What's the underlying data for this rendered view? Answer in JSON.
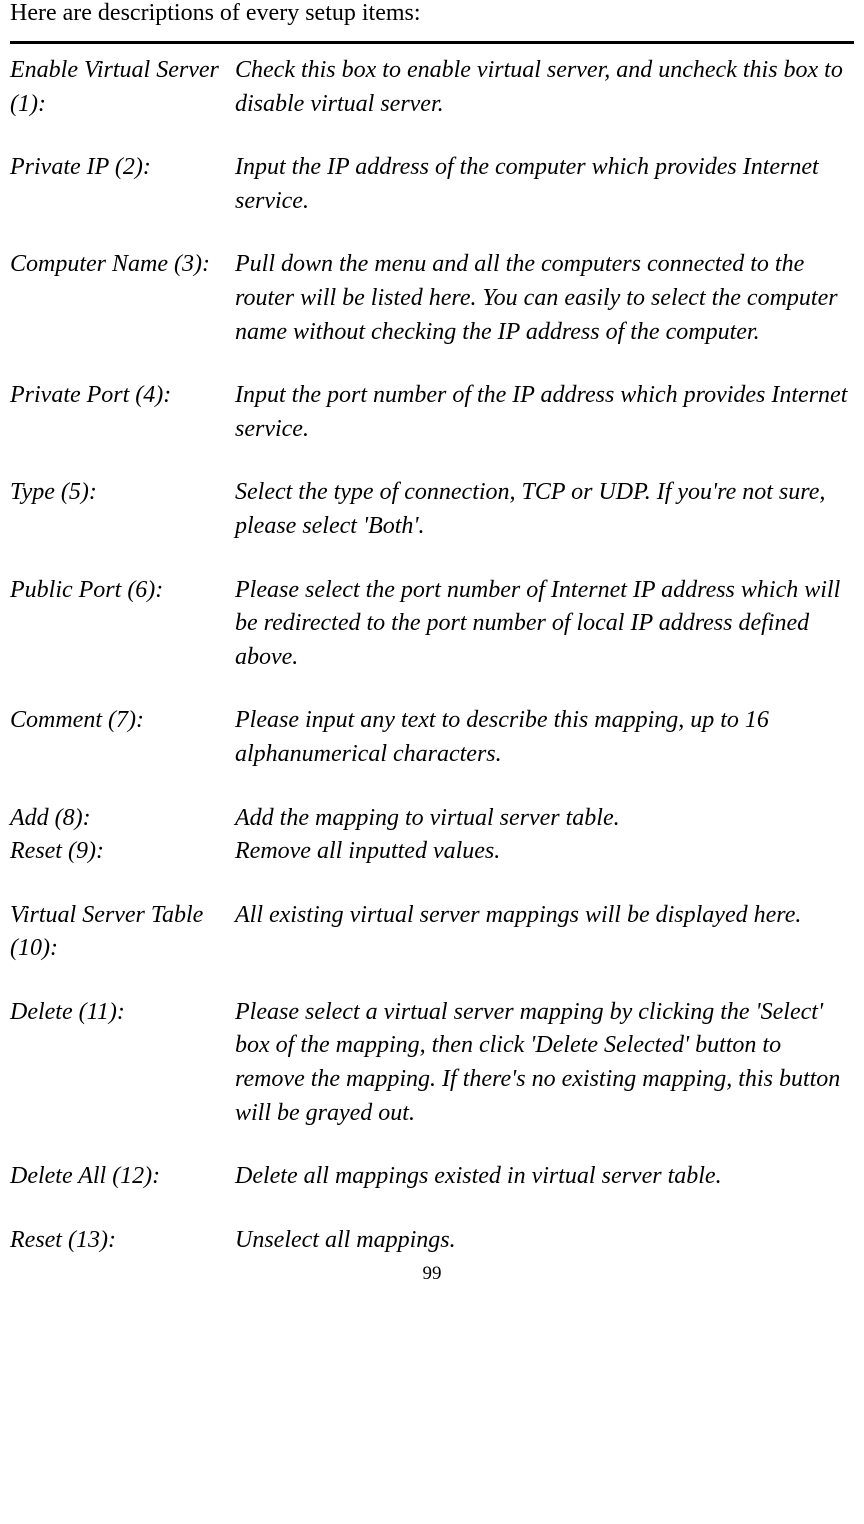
{
  "intro": "Here are descriptions of every setup items:",
  "rows": [
    {
      "left": "Enable Virtual Server (1):",
      "right": "Check this box to enable virtual server, and uncheck this box to disable virtual server."
    },
    {
      "left": "Private IP (2):",
      "right": "Input the IP address of the computer which provides Internet service."
    },
    {
      "left": "Computer Name (3):",
      "right": "Pull down the menu and all the computers connected to the router will be listed here. You can easily to select the computer name without checking the IP address of the computer."
    },
    {
      "left": "Private Port (4):",
      "right": "Input the port number of the IP address which provides Internet service."
    },
    {
      "left": "Type (5):",
      "right": "Select the type of connection, TCP or UDP. If you're not sure, please select 'Both'."
    },
    {
      "left": "Public Port (6):",
      "right": "Please select the port number of Internet IP address which will be redirected to the port number of local IP address defined above."
    },
    {
      "left": "Comment (7):",
      "right": "Please input any text to describe this mapping, up to 16 alphanumerical characters."
    },
    {
      "left": "Add (8):",
      "right": "Add the mapping to virtual server table."
    },
    {
      "left": "Reset (9):",
      "right": "Remove all inputted values."
    },
    {
      "left": "Virtual Server Table (10):",
      "right": "All existing virtual server mappings will be displayed here."
    },
    {
      "left": "Delete (11):",
      "right": "Please select a virtual server mapping by clicking the 'Select' box of the mapping, then click 'Delete Selected' button to remove the mapping. If there's no existing mapping, this button will be grayed out."
    },
    {
      "left": "Delete All (12):",
      "right": "Delete all mappings existed in virtual server table."
    },
    {
      "left": "Reset (13):",
      "right": "Unselect all mappings."
    }
  ],
  "pageNumber": "99"
}
